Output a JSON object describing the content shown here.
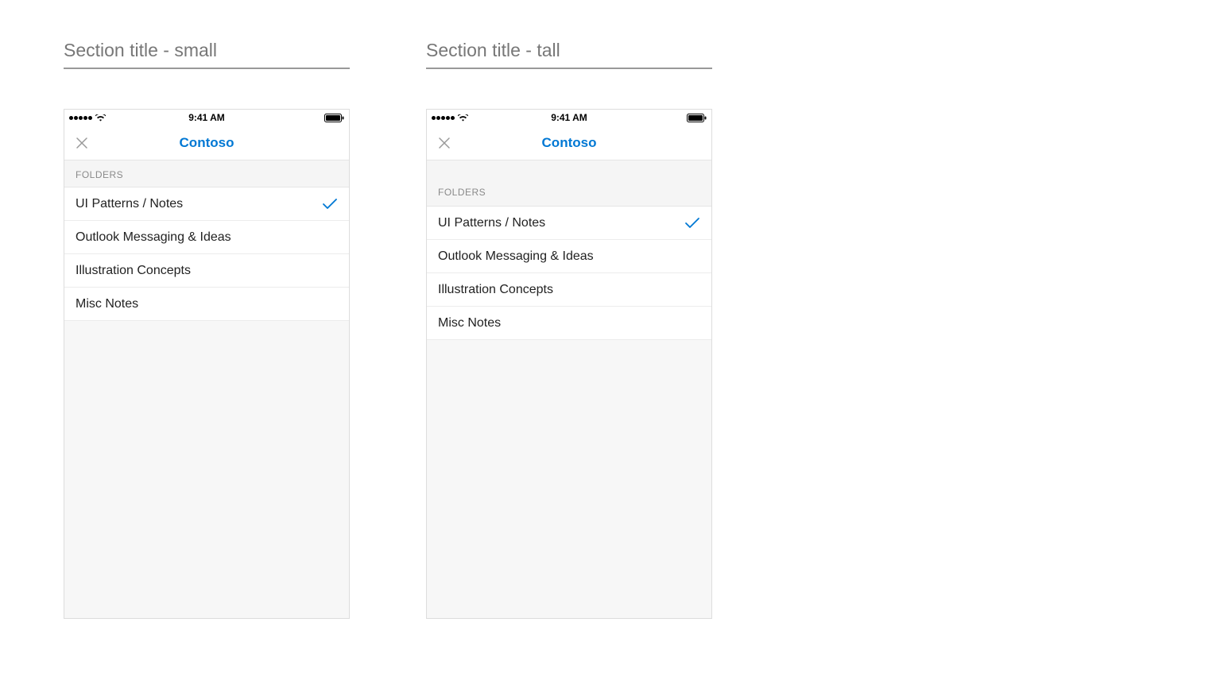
{
  "sections": {
    "small": {
      "title": "Section title - small"
    },
    "tall": {
      "title": "Section title - tall"
    }
  },
  "statusBar": {
    "time": "9:41 AM"
  },
  "navBar": {
    "title": "Contoso"
  },
  "folderSection": {
    "header": "FOLDERS",
    "items": {
      "0": {
        "label": "UI Patterns / Notes",
        "selected": true
      },
      "1": {
        "label": "Outlook Messaging & Ideas",
        "selected": false
      },
      "2": {
        "label": "Illustration Concepts",
        "selected": false
      },
      "3": {
        "label": "Misc Notes",
        "selected": false
      }
    }
  },
  "colors": {
    "accent": "#0078d4"
  }
}
